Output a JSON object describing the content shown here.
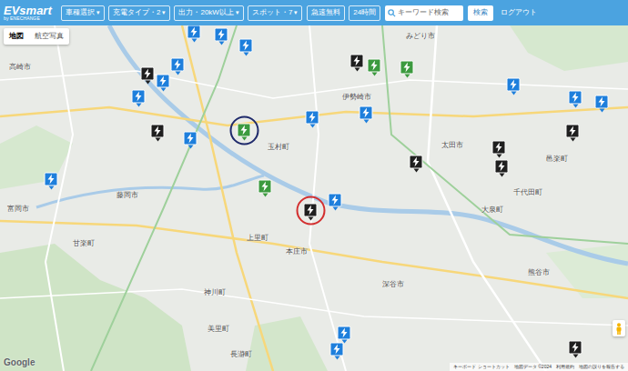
{
  "header": {
    "logo": "EVsmart",
    "logo_sub": "by ENECHANGE",
    "filters": [
      {
        "label": "車種選択",
        "arrow": "▾"
      },
      {
        "label": "充電タイプ・2",
        "arrow": "▾"
      },
      {
        "label": "出力・20kW以上",
        "arrow": "▾"
      },
      {
        "label": "スポット・7",
        "arrow": "▾"
      }
    ],
    "toggles": [
      "急速無料",
      "24時間"
    ],
    "search": {
      "placeholder": "キーワード検索"
    },
    "search_button": "検索",
    "logout": "ログアウト"
  },
  "map_types": [
    {
      "label": "地図",
      "selected": true
    },
    {
      "label": "航空写真",
      "selected": false
    }
  ],
  "map": {
    "labels": [
      "高崎市",
      "玉村町",
      "伊勢崎市",
      "太田市",
      "大泉町",
      "千代田町",
      "熊谷市",
      "本庄市",
      "深谷市",
      "上里町",
      "神川町",
      "美里町",
      "長瀞町",
      "藤岡市",
      "甘楽町",
      "富岡市",
      "みどり市",
      "邑楽町"
    ],
    "pins": [
      {
        "kind": "blue",
        "circled": false
      },
      {
        "kind": "blue",
        "circled": false
      },
      {
        "kind": "blue",
        "circled": false
      },
      {
        "kind": "black",
        "circled": false
      },
      {
        "kind": "blue",
        "circled": false
      },
      {
        "kind": "blue",
        "circled": false
      },
      {
        "kind": "blue",
        "circled": false
      },
      {
        "kind": "black",
        "circled": false
      },
      {
        "kind": "blue",
        "circled": false
      },
      {
        "kind": "green",
        "circled": true,
        "ring_color": "#1f2a6b"
      },
      {
        "kind": "blue",
        "circled": false
      },
      {
        "kind": "blue",
        "circled": false
      },
      {
        "kind": "green",
        "circled": false
      },
      {
        "kind": "green",
        "circled": false
      },
      {
        "kind": "black",
        "circled": false
      },
      {
        "kind": "black",
        "circled": false
      },
      {
        "kind": "black",
        "circled": false
      },
      {
        "kind": "black",
        "circled": false
      },
      {
        "kind": "blue",
        "circled": false
      },
      {
        "kind": "blue",
        "circled": false
      },
      {
        "kind": "black",
        "circled": false
      },
      {
        "kind": "blue",
        "circled": false
      },
      {
        "kind": "green",
        "circled": false
      },
      {
        "kind": "black",
        "circled": true,
        "ring_color": "#d32f2f"
      },
      {
        "kind": "blue",
        "circled": false
      },
      {
        "kind": "blue",
        "circled": false
      },
      {
        "kind": "blue",
        "circled": false
      },
      {
        "kind": "black",
        "circled": false
      },
      {
        "kind": "blue",
        "circled": false
      }
    ]
  },
  "footer": {
    "logo": "Google",
    "attributions": [
      "キーボード ショートカット",
      "地図データ ©2024",
      "利用規約",
      "地図の誤りを報告する"
    ]
  }
}
